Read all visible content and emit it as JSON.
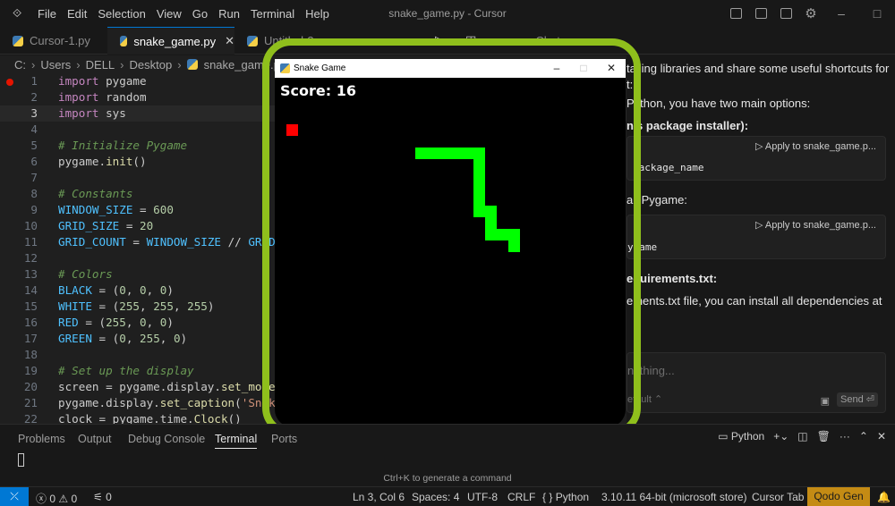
{
  "menu": [
    "File",
    "Edit",
    "Selection",
    "View",
    "Go",
    "Run",
    "Terminal",
    "Help"
  ],
  "window_title": "snake_game.py - Cursor",
  "tabs": [
    {
      "label": "Cursor-1.py",
      "active": false
    },
    {
      "label": "snake_game.py",
      "active": true
    },
    {
      "label": "Untitled-3",
      "active": false
    }
  ],
  "chat_tab": "Chat",
  "breadcrumb": [
    "C:",
    "Users",
    "DELL",
    "Desktop",
    "snake_game.py"
  ],
  "code": [
    {
      "n": "1",
      "t": "import pygame"
    },
    {
      "n": "2",
      "t": "import random"
    },
    {
      "n": "3",
      "t": "import sys"
    },
    {
      "n": "4",
      "t": ""
    },
    {
      "n": "5",
      "t": "# Initialize Pygame"
    },
    {
      "n": "6",
      "t": "pygame.init()"
    },
    {
      "n": "7",
      "t": ""
    },
    {
      "n": "8",
      "t": "# Constants"
    },
    {
      "n": "9",
      "t": "WINDOW_SIZE = 600"
    },
    {
      "n": "10",
      "t": "GRID_SIZE = 20"
    },
    {
      "n": "11",
      "t": "GRID_COUNT = WINDOW_SIZE // GRID_S"
    },
    {
      "n": "12",
      "t": ""
    },
    {
      "n": "13",
      "t": "# Colors"
    },
    {
      "n": "14",
      "t": "BLACK = (0, 0, 0)"
    },
    {
      "n": "15",
      "t": "WHITE = (255, 255, 255)"
    },
    {
      "n": "16",
      "t": "RED = (255, 0, 0)"
    },
    {
      "n": "17",
      "t": "GREEN = (0, 255, 0)"
    },
    {
      "n": "18",
      "t": ""
    },
    {
      "n": "19",
      "t": "# Set up the display"
    },
    {
      "n": "20",
      "t": "screen = pygame.display.set_mode("
    },
    {
      "n": "21",
      "t": "pygame.display.set_caption('Snake"
    },
    {
      "n": "22",
      "t": "clock = pygame.time.Clock()"
    }
  ],
  "chat": {
    "line1": "talling libraries and share some useful shortcuts for",
    "line2": "t:",
    "line3": "Python, you have two main options:",
    "line4": "n's package installer):",
    "apply1": "Apply to snake_game.p...",
    "code1": "package_name",
    "line5": "all Pygame:",
    "apply2": "Apply to snake_game.p...",
    "code2": "ygame",
    "line6": "equirements.txt:",
    "line7": "ements.txt file, you can install all dependencies at",
    "input_placeholder": "nything...",
    "model": "efault",
    "send": "Send"
  },
  "game": {
    "title": "Snake Game",
    "score": "Score: 16"
  },
  "panel": {
    "tabs": [
      "Problems",
      "Output",
      "Debug Console",
      "Terminal",
      "Ports"
    ],
    "active": "Terminal",
    "shell": "Python",
    "hint": "Ctrl+K to generate a command"
  },
  "status": {
    "errors": "0",
    "warnings": "0",
    "ports": "0",
    "position": "Ln 3, Col 6",
    "spaces": "Spaces: 4",
    "encoding": "UTF-8",
    "eol": "CRLF",
    "language": "Python",
    "interpreter": "3.10.11 64-bit (microsoft store)",
    "cursor_tab": "Cursor Tab",
    "qodo": "Qodo Gen"
  },
  "colors": {
    "accent": "#0078d4",
    "highlight_ring": "#8fbf1c",
    "snake": "#00ff00",
    "food": "#ff0000",
    "qodo": "#c48b14"
  }
}
